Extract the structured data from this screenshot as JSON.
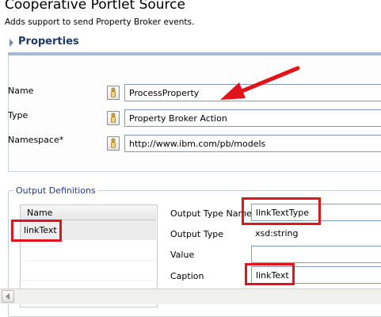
{
  "page": {
    "title": "Cooperative Portlet Source",
    "description": "Adds support to send Property Broker events."
  },
  "properties": {
    "section_title": "Properties",
    "fields": [
      {
        "label": "Name",
        "value": "ProcessProperty"
      },
      {
        "label": "Type",
        "value": "Property Broker Action"
      },
      {
        "label": "Namespace*",
        "value": "http://www.ibm.com/pb/models"
      }
    ]
  },
  "output_definitions": {
    "group_title": "Output Definitions",
    "list_header": "Name",
    "list_items": [
      "linkText"
    ],
    "fields": {
      "output_type_name": {
        "label": "Output Type Name",
        "value": "linkTextType"
      },
      "output_type": {
        "label": "Output Type",
        "value": "xsd:string"
      },
      "value": {
        "label": "Value",
        "value": ""
      },
      "caption": {
        "label": "Caption",
        "value": "linkText"
      }
    }
  },
  "annotations": {
    "highlight_color": "#e0141a",
    "arrow_color": "#e0141a"
  },
  "colors": {
    "section_title": "#1e3a66",
    "group_title": "#1f3c88",
    "section_rule": "#a6b9d4"
  }
}
